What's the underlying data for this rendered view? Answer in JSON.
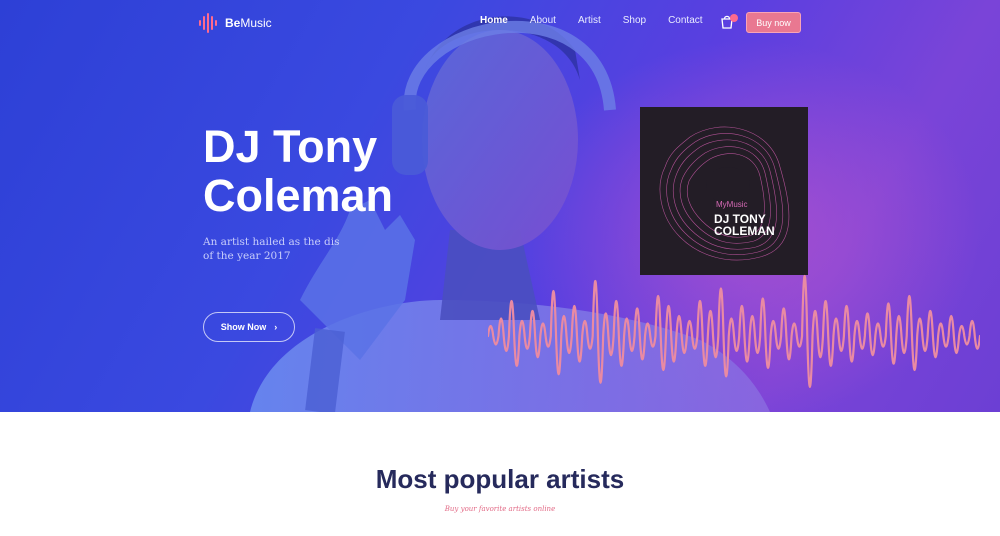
{
  "brand": {
    "name_bold": "Be",
    "name_light": "Music"
  },
  "nav": {
    "items": [
      "Home",
      "About",
      "Artist",
      "Shop",
      "Contact"
    ],
    "active": "Home",
    "buy_label": "Buy now"
  },
  "hero": {
    "title_line1": "DJ Tony",
    "title_line2": "Coleman",
    "subtitle_line1": "An artist hailed as the dis",
    "subtitle_line2": "of the year 2017",
    "cta_label": "Show Now",
    "cta_icon": "chevron-right-icon"
  },
  "album": {
    "brand": "MyMusic",
    "name_line1": "DJ TONY",
    "name_line2": "COLEMAN"
  },
  "section": {
    "title": "Most popular artists",
    "subtitle": "Buy your favorite artists online"
  },
  "colors": {
    "hero_blue": "#3a49e0",
    "accent_pink": "#e97891",
    "wave": "#e98aa3",
    "title_dark": "#262a5c"
  }
}
